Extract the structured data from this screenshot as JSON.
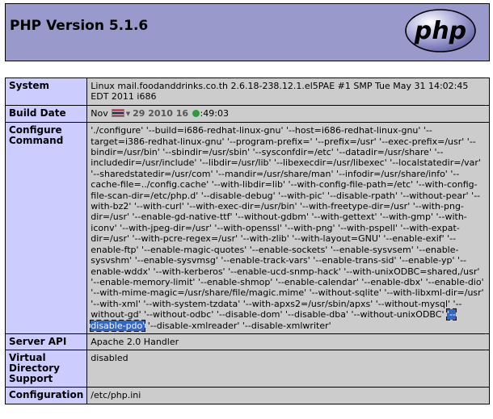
{
  "header": {
    "title": "PHP Version 5.1.6",
    "logo_text": "php"
  },
  "rows": [
    {
      "key": "System",
      "value": "Linux mail.foodanddrinks.co.th 2.6.18-238.12.1.el5PAE #1 SMP Tue May 31 14:02:45 EDT 2011 i686"
    },
    {
      "key": "Build Date",
      "value_prefix": "Nov",
      "value_date": "29 2010 16",
      "value_suffix": ":49:03"
    },
    {
      "key": "Configure Command",
      "value_before": "'./configure' '--build=i686-redhat-linux-gnu' '--host=i686-redhat-linux-gnu' '--target=i386-redhat-linux-gnu' '--program-prefix=' '--prefix=/usr' '--exec-prefix=/usr' '--bindir=/usr/bin' '--sbindir=/usr/sbin' '--sysconfdir=/etc' '--datadir=/usr/share' '--includedir=/usr/include' '--libdir=/usr/lib' '--libexecdir=/usr/libexec' '--localstatedir=/var' '--sharedstatedir=/usr/com' '--mandir=/usr/share/man' '--infodir=/usr/share/info' '--cache-file=../config.cache' '--with-libdir=lib' '--with-config-file-path=/etc' '--with-config-file-scan-dir=/etc/php.d' '--disable-debug' '--with-pic' '--disable-rpath' '--without-pear' '--with-bz2' '--with-curl' '--with-exec-dir=/usr/bin' '--with-freetype-dir=/usr' '--with-png-dir=/usr' '--enable-gd-native-ttf' '--without-gdbm' '--with-gettext' '--with-gmp' '--with-iconv' '--with-jpeg-dir=/usr' '--with-openssl' '--with-png' '--with-pspell' '--with-expat-dir=/usr' '--with-pcre-regex=/usr' '--with-zlib' '--with-layout=GNU' '--enable-exif' '--enable-ftp' '--enable-magic-quotes' '--enable-sockets' '--enable-sysvsem' '--enable-sysvshm' '--enable-sysvmsg' '--enable-track-vars' '--enable-trans-sid' '--enable-yp' '--enable-wddx' '--with-kerberos' '--enable-ucd-snmp-hack' '--with-unixODBC=shared,/usr' '--enable-memory-limit' '--enable-shmop' '--enable-calendar' '--enable-dbx' '--enable-dio' '--with-mime-magic=/usr/share/file/magic.mime' '--without-sqlite' '--with-libxml-dir=/usr' '--with-xml' '--with-system-tzdata' '--with-apxs2=/usr/sbin/apxs' '--without-mysql' '--without-gd' '--without-odbc' '--disable-dom' '--disable-dba' '--without-unixODBC' ",
      "value_highlight": "'--disable-pdo'",
      "value_after": " '--disable-xmlreader' '--disable-xmlwriter'"
    },
    {
      "key": "Server API",
      "value": "Apache 2.0 Handler"
    },
    {
      "key": "Virtual Directory Support",
      "value": "disabled"
    },
    {
      "key": "Configuration",
      "value": "/etc/php.ini"
    }
  ],
  "colors": {
    "header_bg": "#9999cc",
    "key_bg": "#ccccff",
    "value_bg": "#cccccc",
    "highlight": "#3366cc"
  }
}
